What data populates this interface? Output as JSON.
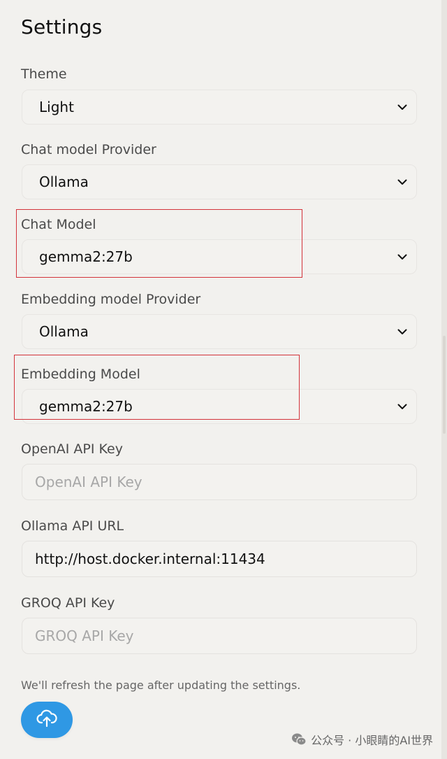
{
  "header": {
    "title": "Settings"
  },
  "theme": {
    "label": "Theme",
    "value": "Light"
  },
  "chat_provider": {
    "label": "Chat model Provider",
    "value": "Ollama"
  },
  "chat_model": {
    "label": "Chat Model",
    "value": "gemma2:27b"
  },
  "embedding_provider": {
    "label": "Embedding model Provider",
    "value": "Ollama"
  },
  "embedding_model": {
    "label": "Embedding Model",
    "value": "gemma2:27b"
  },
  "openai": {
    "label": "OpenAI API Key",
    "placeholder": "OpenAI API Key",
    "value": ""
  },
  "ollama_url": {
    "label": "Ollama API URL",
    "value": "http://host.docker.internal:11434"
  },
  "groq": {
    "label": "GROQ API Key",
    "placeholder": "GROQ API Key",
    "value": ""
  },
  "footer": {
    "note": "We'll refresh the page after updating the settings.",
    "upload_icon": "cloud-upload-icon"
  },
  "watermark": {
    "text": "公众号 · 小眼睛的AI世界",
    "icon": "wechat-icon"
  },
  "colors": {
    "accent": "#2f98e4",
    "highlight": "#d3333b",
    "background": "#f2f1ee"
  }
}
